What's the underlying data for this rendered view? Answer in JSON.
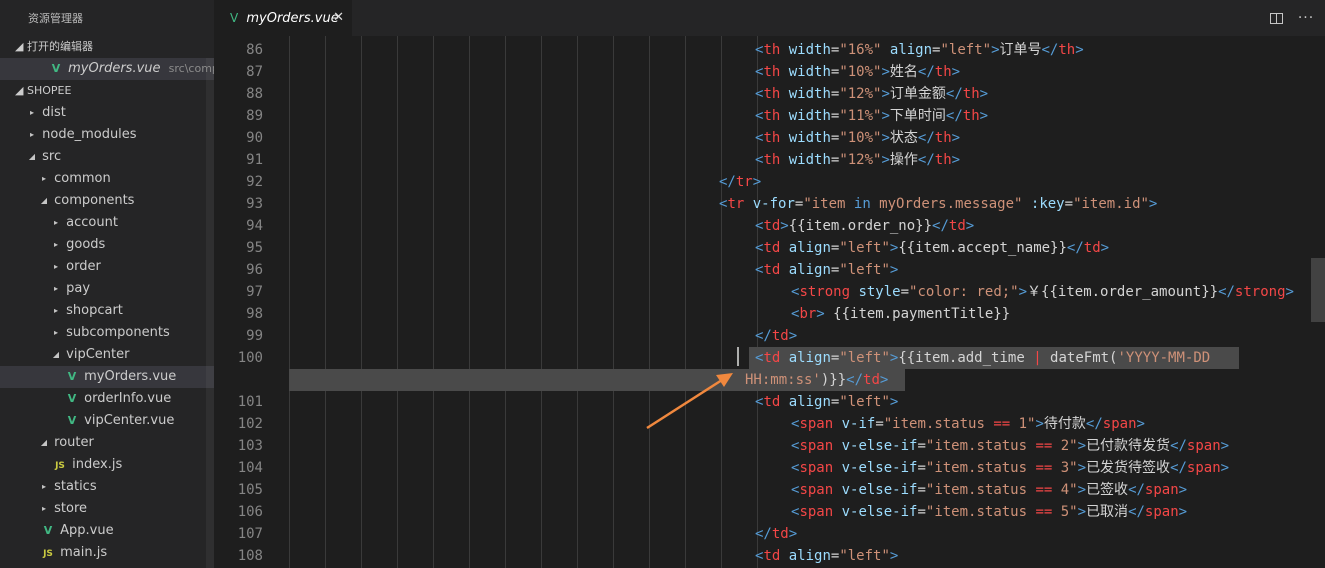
{
  "sidebar": {
    "title": "资源管理器",
    "open_editors": {
      "label": "打开的编辑器",
      "file": "myOrders.vue",
      "path": "src\\compon..."
    },
    "project": "SHOPEE",
    "tree": [
      {
        "label": "dist",
        "kind": "folder-closed",
        "depth": 1
      },
      {
        "label": "node_modules",
        "kind": "folder-closed",
        "depth": 1
      },
      {
        "label": "src",
        "kind": "folder-open",
        "depth": 1
      },
      {
        "label": "common",
        "kind": "folder-closed",
        "depth": 2
      },
      {
        "label": "components",
        "kind": "folder-open",
        "depth": 2
      },
      {
        "label": "account",
        "kind": "folder-closed",
        "depth": 3
      },
      {
        "label": "goods",
        "kind": "folder-closed",
        "depth": 3
      },
      {
        "label": "order",
        "kind": "folder-closed",
        "depth": 3
      },
      {
        "label": "pay",
        "kind": "folder-closed",
        "depth": 3
      },
      {
        "label": "shopcart",
        "kind": "folder-closed",
        "depth": 3
      },
      {
        "label": "subcomponents",
        "kind": "folder-closed",
        "depth": 3
      },
      {
        "label": "vipCenter",
        "kind": "folder-open",
        "depth": 3
      },
      {
        "label": "myOrders.vue",
        "kind": "vue",
        "depth": 4,
        "active": true
      },
      {
        "label": "orderInfo.vue",
        "kind": "vue",
        "depth": 4
      },
      {
        "label": "vipCenter.vue",
        "kind": "vue",
        "depth": 4
      },
      {
        "label": "router",
        "kind": "folder-open",
        "depth": 2
      },
      {
        "label": "index.js",
        "kind": "js",
        "depth": 3
      },
      {
        "label": "statics",
        "kind": "folder-closed",
        "depth": 2
      },
      {
        "label": "store",
        "kind": "folder-closed",
        "depth": 2
      },
      {
        "label": "App.vue",
        "kind": "vue",
        "depth": 2
      },
      {
        "label": "main.js",
        "kind": "js",
        "depth": 2
      }
    ]
  },
  "tab": {
    "label": "myOrders.vue",
    "close": "✕"
  },
  "toolbar": {
    "split_editor": "split-editor-icon",
    "more": "···"
  },
  "icons": {
    "vue": "V",
    "js": "JS",
    "chevron_right": "▸",
    "chevron_down": "◢"
  },
  "colors": {
    "tag": "#569cd6",
    "tag_name": "#f44747",
    "attr": "#9cdcfe",
    "string": "#ce9178",
    "text": "#d4d4d4",
    "arrow": "#f0883e"
  },
  "editor": {
    "lines": [
      {
        "n": "86",
        "indent": 13,
        "tokens": [
          [
            "t",
            "<"
          ],
          [
            "tn",
            "th"
          ],
          [
            "a",
            " width"
          ],
          [
            "txt",
            "="
          ],
          [
            "s",
            "\"16%\""
          ],
          [
            "a",
            " align"
          ],
          [
            "txt",
            "="
          ],
          [
            "s",
            "\"left\""
          ],
          [
            "t",
            ">"
          ],
          [
            "txt",
            "订单号"
          ],
          [
            "t",
            "</"
          ],
          [
            "tn",
            "th"
          ],
          [
            "t",
            ">"
          ]
        ]
      },
      {
        "n": "87",
        "indent": 13,
        "tokens": [
          [
            "t",
            "<"
          ],
          [
            "tn",
            "th"
          ],
          [
            "a",
            " width"
          ],
          [
            "txt",
            "="
          ],
          [
            "s",
            "\"10%\""
          ],
          [
            "t",
            ">"
          ],
          [
            "txt",
            "姓名"
          ],
          [
            "t",
            "</"
          ],
          [
            "tn",
            "th"
          ],
          [
            "t",
            ">"
          ]
        ]
      },
      {
        "n": "88",
        "indent": 13,
        "tokens": [
          [
            "t",
            "<"
          ],
          [
            "tn",
            "th"
          ],
          [
            "a",
            " width"
          ],
          [
            "txt",
            "="
          ],
          [
            "s",
            "\"12%\""
          ],
          [
            "t",
            ">"
          ],
          [
            "txt",
            "订单金额"
          ],
          [
            "t",
            "</"
          ],
          [
            "tn",
            "th"
          ],
          [
            "t",
            ">"
          ]
        ]
      },
      {
        "n": "89",
        "indent": 13,
        "tokens": [
          [
            "t",
            "<"
          ],
          [
            "tn",
            "th"
          ],
          [
            "a",
            " width"
          ],
          [
            "txt",
            "="
          ],
          [
            "s",
            "\"11%\""
          ],
          [
            "t",
            ">"
          ],
          [
            "txt",
            "下单时间"
          ],
          [
            "t",
            "</"
          ],
          [
            "tn",
            "th"
          ],
          [
            "t",
            ">"
          ]
        ]
      },
      {
        "n": "90",
        "indent": 13,
        "tokens": [
          [
            "t",
            "<"
          ],
          [
            "tn",
            "th"
          ],
          [
            "a",
            " width"
          ],
          [
            "txt",
            "="
          ],
          [
            "s",
            "\"10%\""
          ],
          [
            "t",
            ">"
          ],
          [
            "txt",
            "状态"
          ],
          [
            "t",
            "</"
          ],
          [
            "tn",
            "th"
          ],
          [
            "t",
            ">"
          ]
        ]
      },
      {
        "n": "91",
        "indent": 13,
        "tokens": [
          [
            "t",
            "<"
          ],
          [
            "tn",
            "th"
          ],
          [
            "a",
            " width"
          ],
          [
            "txt",
            "="
          ],
          [
            "s",
            "\"12%\""
          ],
          [
            "t",
            ">"
          ],
          [
            "txt",
            "操作"
          ],
          [
            "t",
            "</"
          ],
          [
            "tn",
            "th"
          ],
          [
            "t",
            ">"
          ]
        ]
      },
      {
        "n": "92",
        "indent": 12,
        "tokens": [
          [
            "t",
            "</"
          ],
          [
            "tn",
            "tr"
          ],
          [
            "t",
            ">"
          ]
        ]
      },
      {
        "n": "93",
        "indent": 12,
        "tokens": [
          [
            "t",
            "<"
          ],
          [
            "tn",
            "tr"
          ],
          [
            "a",
            " v-for"
          ],
          [
            "txt",
            "="
          ],
          [
            "s",
            "\"item "
          ],
          [
            "t",
            "in"
          ],
          [
            "s",
            " myOrders.message\""
          ],
          [
            "a",
            " :key"
          ],
          [
            "txt",
            "="
          ],
          [
            "s",
            "\"item.id\""
          ],
          [
            "t",
            ">"
          ]
        ]
      },
      {
        "n": "94",
        "indent": 13,
        "tokens": [
          [
            "t",
            "<"
          ],
          [
            "tn",
            "td"
          ],
          [
            "t",
            ">"
          ],
          [
            "txt",
            "{{item.order_no}}"
          ],
          [
            "t",
            "</"
          ],
          [
            "tn",
            "td"
          ],
          [
            "t",
            ">"
          ]
        ]
      },
      {
        "n": "95",
        "indent": 13,
        "tokens": [
          [
            "t",
            "<"
          ],
          [
            "tn",
            "td"
          ],
          [
            "a",
            " align"
          ],
          [
            "txt",
            "="
          ],
          [
            "s",
            "\"left\""
          ],
          [
            "t",
            ">"
          ],
          [
            "txt",
            "{{item.accept_name}}"
          ],
          [
            "t",
            "</"
          ],
          [
            "tn",
            "td"
          ],
          [
            "t",
            ">"
          ]
        ]
      },
      {
        "n": "96",
        "indent": 13,
        "tokens": [
          [
            "t",
            "<"
          ],
          [
            "tn",
            "td"
          ],
          [
            "a",
            " align"
          ],
          [
            "txt",
            "="
          ],
          [
            "s",
            "\"left\""
          ],
          [
            "t",
            ">"
          ]
        ]
      },
      {
        "n": "97",
        "indent": 14,
        "tokens": [
          [
            "t",
            "<"
          ],
          [
            "tn",
            "strong"
          ],
          [
            "a",
            " style"
          ],
          [
            "txt",
            "="
          ],
          [
            "s",
            "\"color: red;\""
          ],
          [
            "t",
            ">"
          ],
          [
            "txt",
            "￥{{item.order_amount}}"
          ],
          [
            "t",
            "</"
          ],
          [
            "tn",
            "strong"
          ],
          [
            "t",
            ">"
          ]
        ]
      },
      {
        "n": "98",
        "indent": 14,
        "tokens": [
          [
            "t",
            "<"
          ],
          [
            "tn",
            "br"
          ],
          [
            "t",
            ">"
          ],
          [
            "txt",
            " {{item.paymentTitle}}"
          ]
        ]
      },
      {
        "n": "99",
        "indent": 13,
        "tokens": [
          [
            "t",
            "</"
          ],
          [
            "tn",
            "td"
          ],
          [
            "t",
            ">"
          ]
        ]
      },
      {
        "n": "100",
        "indent": 13,
        "hl": true,
        "tokens": [
          [
            "t",
            "<"
          ],
          [
            "tn",
            "td"
          ],
          [
            "a",
            " align"
          ],
          [
            "txt",
            "="
          ],
          [
            "s",
            "\"left\""
          ],
          [
            "t",
            ">"
          ],
          [
            "txt",
            "{{item.add_time "
          ],
          [
            "tn",
            "|"
          ],
          [
            "txt",
            " dateFmt("
          ],
          [
            "s",
            "'YYYY-MM-DD"
          ]
        ]
      },
      {
        "n": "",
        "indent": 13,
        "hlfull": true,
        "tokens": [
          [
            "s",
            "HH:mm:ss'"
          ],
          [
            "txt",
            ")}}"
          ],
          [
            "t",
            "</"
          ],
          [
            "tn",
            "td"
          ],
          [
            "t",
            ">"
          ]
        ]
      },
      {
        "n": "101",
        "indent": 13,
        "tokens": [
          [
            "t",
            "<"
          ],
          [
            "tn",
            "td"
          ],
          [
            "a",
            " align"
          ],
          [
            "txt",
            "="
          ],
          [
            "s",
            "\"left\""
          ],
          [
            "t",
            ">"
          ]
        ]
      },
      {
        "n": "102",
        "indent": 14,
        "tokens": [
          [
            "t",
            "<"
          ],
          [
            "tn",
            "span"
          ],
          [
            "a",
            " v-if"
          ],
          [
            "txt",
            "="
          ],
          [
            "s",
            "\"item.status "
          ],
          [
            "tn",
            "=="
          ],
          [
            "s",
            " 1\""
          ],
          [
            "t",
            ">"
          ],
          [
            "txt",
            "待付款"
          ],
          [
            "t",
            "</"
          ],
          [
            "tn",
            "span"
          ],
          [
            "t",
            ">"
          ]
        ]
      },
      {
        "n": "103",
        "indent": 14,
        "tokens": [
          [
            "t",
            "<"
          ],
          [
            "tn",
            "span"
          ],
          [
            "a",
            " v-else-if"
          ],
          [
            "txt",
            "="
          ],
          [
            "s",
            "\"item.status "
          ],
          [
            "tn",
            "=="
          ],
          [
            "s",
            " 2\""
          ],
          [
            "t",
            ">"
          ],
          [
            "txt",
            "已付款待发货"
          ],
          [
            "t",
            "</"
          ],
          [
            "tn",
            "span"
          ],
          [
            "t",
            ">"
          ]
        ]
      },
      {
        "n": "104",
        "indent": 14,
        "tokens": [
          [
            "t",
            "<"
          ],
          [
            "tn",
            "span"
          ],
          [
            "a",
            " v-else-if"
          ],
          [
            "txt",
            "="
          ],
          [
            "s",
            "\"item.status "
          ],
          [
            "tn",
            "=="
          ],
          [
            "s",
            " 3\""
          ],
          [
            "t",
            ">"
          ],
          [
            "txt",
            "已发货待签收"
          ],
          [
            "t",
            "</"
          ],
          [
            "tn",
            "span"
          ],
          [
            "t",
            ">"
          ]
        ]
      },
      {
        "n": "105",
        "indent": 14,
        "tokens": [
          [
            "t",
            "<"
          ],
          [
            "tn",
            "span"
          ],
          [
            "a",
            " v-else-if"
          ],
          [
            "txt",
            "="
          ],
          [
            "s",
            "\"item.status "
          ],
          [
            "tn",
            "=="
          ],
          [
            "s",
            " 4\""
          ],
          [
            "t",
            ">"
          ],
          [
            "txt",
            "已签收"
          ],
          [
            "t",
            "</"
          ],
          [
            "tn",
            "span"
          ],
          [
            "t",
            ">"
          ]
        ]
      },
      {
        "n": "106",
        "indent": 14,
        "tokens": [
          [
            "t",
            "<"
          ],
          [
            "tn",
            "span"
          ],
          [
            "a",
            " v-else-if"
          ],
          [
            "txt",
            "="
          ],
          [
            "s",
            "\"item.status "
          ],
          [
            "tn",
            "=="
          ],
          [
            "s",
            " 5\""
          ],
          [
            "t",
            ">"
          ],
          [
            "txt",
            "已取消"
          ],
          [
            "t",
            "</"
          ],
          [
            "tn",
            "span"
          ],
          [
            "t",
            ">"
          ]
        ]
      },
      {
        "n": "107",
        "indent": 13,
        "tokens": [
          [
            "t",
            "</"
          ],
          [
            "tn",
            "td"
          ],
          [
            "t",
            ">"
          ]
        ]
      },
      {
        "n": "108",
        "indent": 13,
        "tokens": [
          [
            "t",
            "<"
          ],
          [
            "tn",
            "td"
          ],
          [
            "a",
            " align"
          ],
          [
            "txt",
            "="
          ],
          [
            "s",
            "\"left\""
          ],
          [
            "t",
            ">"
          ]
        ]
      }
    ]
  }
}
